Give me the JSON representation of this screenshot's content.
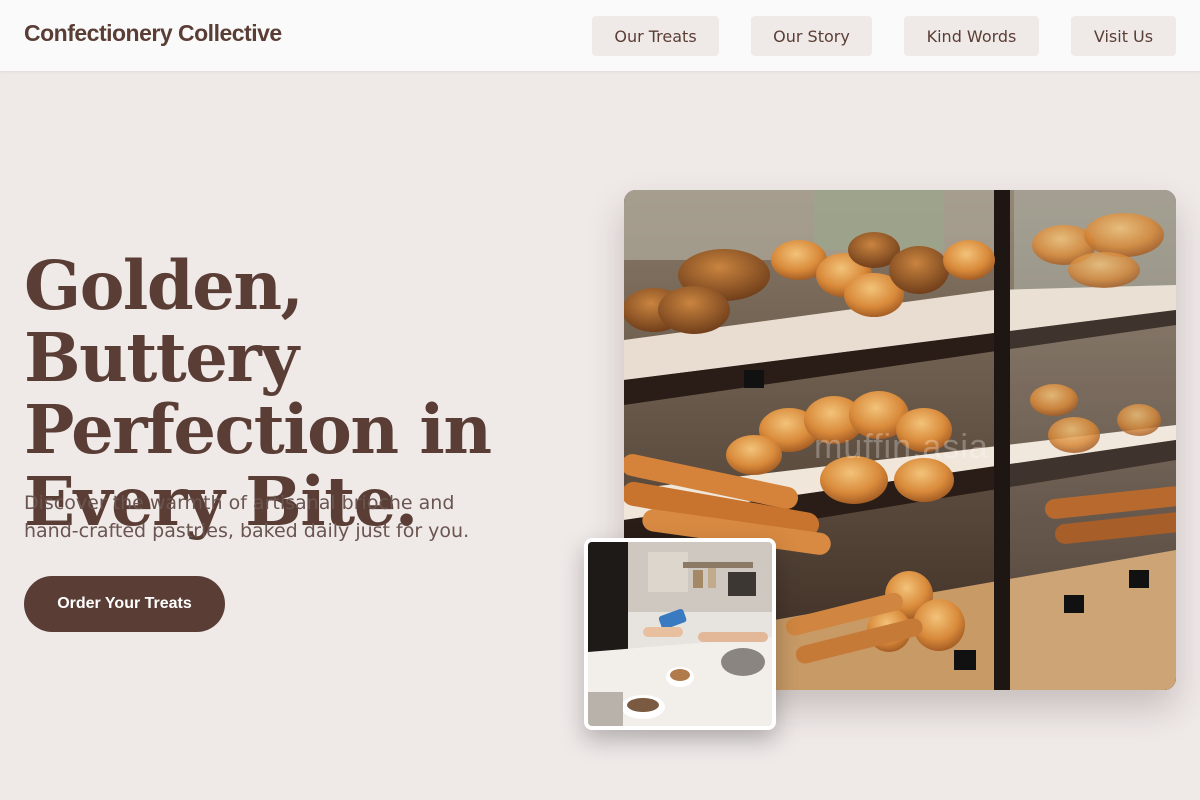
{
  "brand": "Confectionery Collective",
  "nav": {
    "items": [
      {
        "label": "Our Treats"
      },
      {
        "label": "Our Story"
      },
      {
        "label": "Kind Words"
      },
      {
        "label": "Visit Us"
      }
    ]
  },
  "hero": {
    "headline": "Golden, Buttery Perfection in Every Bite.",
    "subtext": "Discover the warmth of artisanal brioche and hand-crafted pastries, baked daily just for you.",
    "cta_label": "Order Your Treats",
    "watermark": "muffin.asia"
  },
  "colors": {
    "brand_brown": "#5a3e36",
    "page_bg": "#efe9e8",
    "nav_bg": "#fafafa",
    "nav_button_bg": "#efe9e8"
  }
}
